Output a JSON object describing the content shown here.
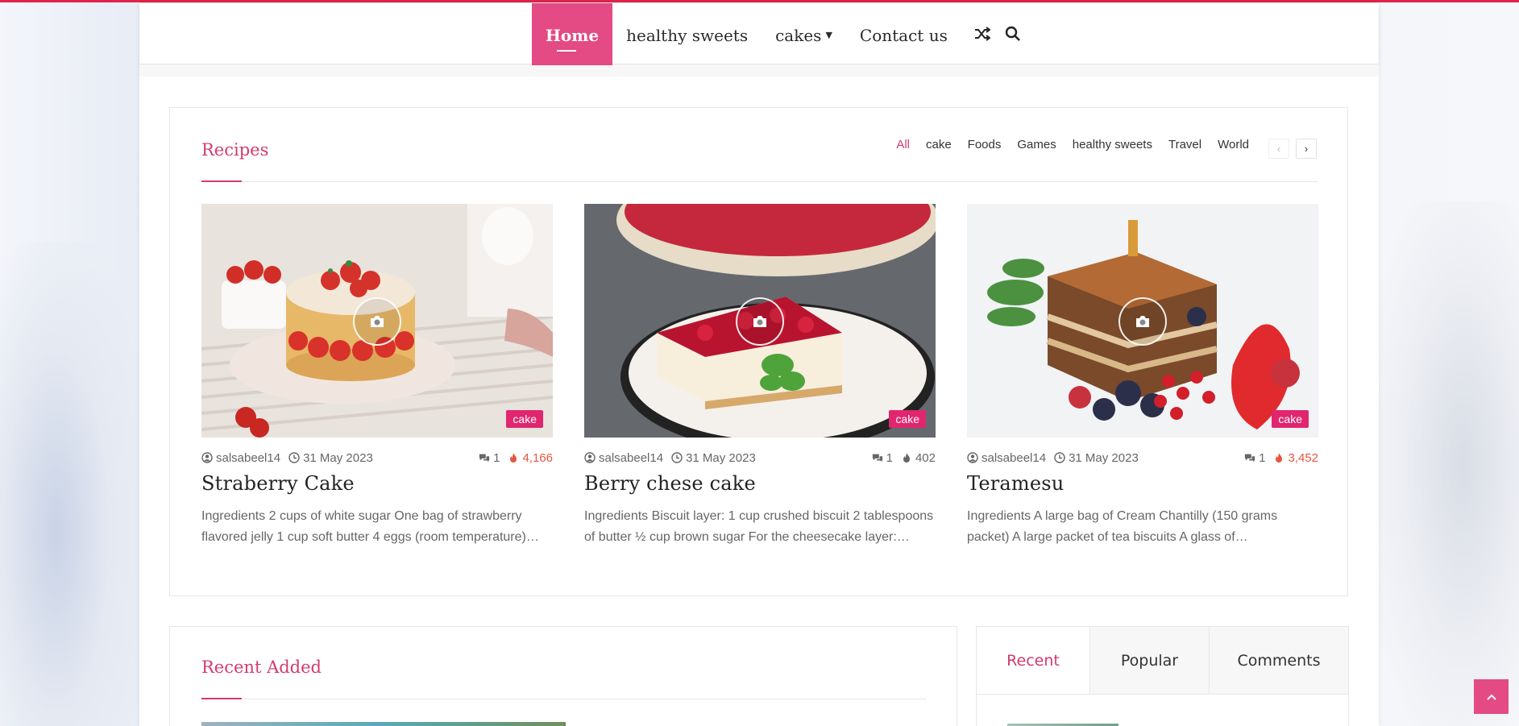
{
  "nav": {
    "items": [
      {
        "label": "Home"
      },
      {
        "label": "healthy sweets"
      },
      {
        "label": "cakes"
      },
      {
        "label": "Contact us"
      }
    ]
  },
  "recipes": {
    "title": "Recipes",
    "filters": [
      "All",
      "cake",
      "Foods",
      "Games",
      "healthy sweets",
      "Travel",
      "World"
    ],
    "posts": [
      {
        "category": "cake",
        "author": "salsabeel14",
        "date": "31 May 2023",
        "comments": "1",
        "views": "4,166",
        "title": "Straberry Cake",
        "excerpt": "Ingredients 2 cups of white sugar One bag of strawberry flavored jelly 1 cup soft butter 4 eggs (room temperature)…"
      },
      {
        "category": "cake",
        "author": "salsabeel14",
        "date": "31 May 2023",
        "comments": "1",
        "views": "402",
        "title": "Berry chese cake",
        "excerpt": "Ingredients Biscuit layer: 1 cup crushed biscuit 2 tablespoons of butter ½ cup brown sugar For the cheesecake layer:…"
      },
      {
        "category": "cake",
        "author": "salsabeel14",
        "date": "31 May 2023",
        "comments": "1",
        "views": "3,452",
        "title": "Teramesu",
        "excerpt": "Ingredients A large bag of Cream Chantilly (150 grams packet) A large packet of tea biscuits A glass of…"
      }
    ]
  },
  "recent_added": {
    "title": "Recent Added"
  },
  "sidebar_tabs": [
    "Recent",
    "Popular",
    "Comments"
  ],
  "colors": {
    "accent": "#e44a83",
    "title": "#d33b6d",
    "hot": "#e8563f",
    "tag": "#e0266f"
  }
}
